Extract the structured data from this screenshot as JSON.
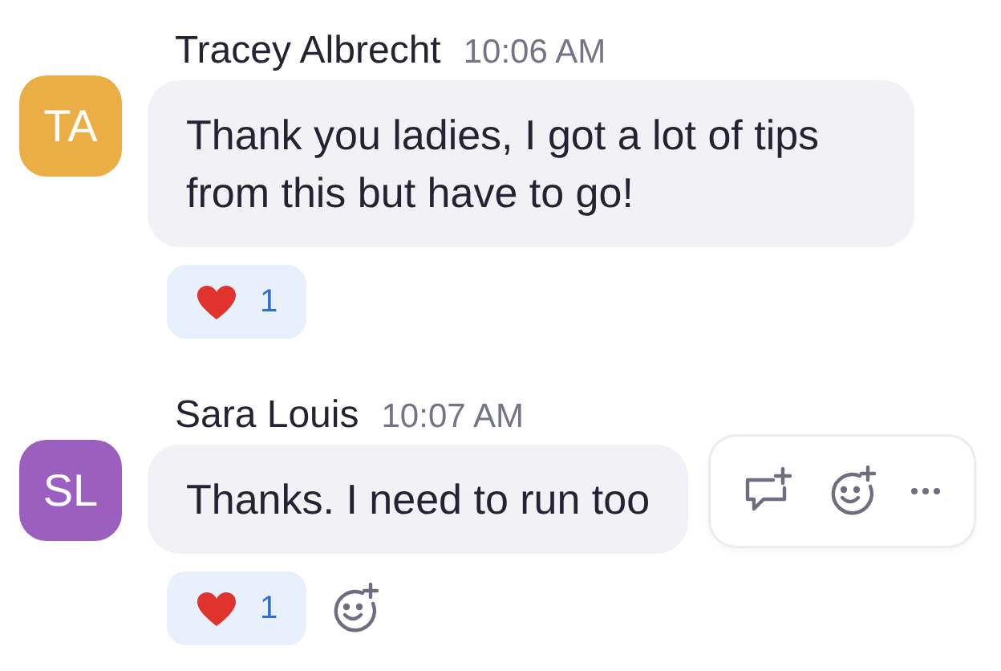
{
  "messages": [
    {
      "sender": "Tracey Albrecht",
      "time": "10:06 AM",
      "initials": "TA",
      "color": "#ebae44",
      "text": "Thank you ladies, I got a lot of tips from this but have to go!",
      "reactions": [
        {
          "count": "1"
        }
      ],
      "hovered": false
    },
    {
      "sender": "Sara Louis",
      "time": "10:07 AM",
      "initials": "SL",
      "color": "#9b5fc0",
      "text": "Thanks. I need to run too",
      "reactions": [
        {
          "count": "1"
        }
      ],
      "hovered": true
    }
  ]
}
